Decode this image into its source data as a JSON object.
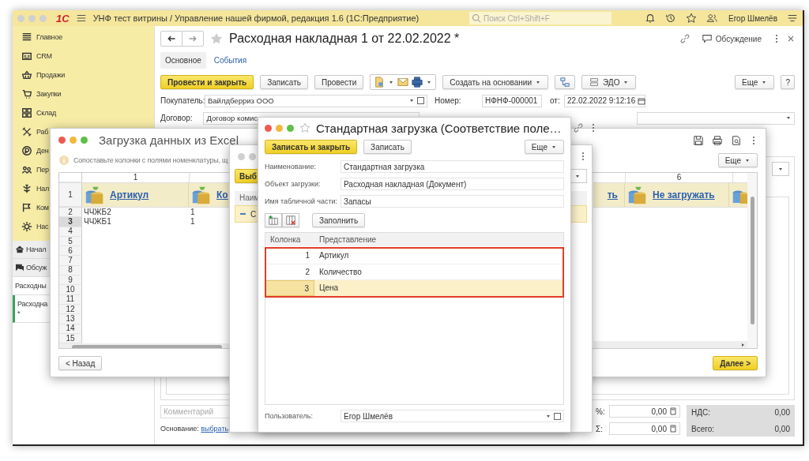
{
  "app": {
    "logo": "1С",
    "title": "УНФ тест витрины / Управление нашей фирмой, редакция 1.6  (1С:Предприятие)",
    "search_placeholder": "Поиск Ctrl+Shift+F",
    "user": "Егор Шмелёв"
  },
  "sidebar": {
    "sections": [
      {
        "label": "Главное"
      },
      {
        "label": "CRM"
      },
      {
        "label": "Продажи"
      },
      {
        "label": "Закупки"
      },
      {
        "label": "Склад"
      },
      {
        "label": "Раб"
      },
      {
        "label": "Ден"
      },
      {
        "label": "Пер"
      },
      {
        "label": "Нал"
      },
      {
        "label": "Ком"
      },
      {
        "label": "Нас"
      }
    ],
    "open_items": [
      {
        "kind": "section",
        "label": "Начал",
        "selected": false
      },
      {
        "kind": "section",
        "label": "Обсуж",
        "selected": false
      },
      {
        "kind": "document",
        "label": "Расходны",
        "selected": false
      },
      {
        "kind": "document",
        "label": "Расходна",
        "note": "*",
        "selected": true
      }
    ]
  },
  "document": {
    "title": "Расходная накладная 1 от 22.02.2022 *",
    "discussion": "Обсуждение",
    "tabs": [
      {
        "label": "Основное",
        "selected": true
      },
      {
        "label": "События",
        "selected": false
      }
    ],
    "toolbar": {
      "primary": "Провести и закрыть",
      "buttons": [
        "Записать",
        "Провести"
      ],
      "create_based": "Создать на основании",
      "edo": "ЭДО",
      "more": "Еще",
      "help": "?"
    },
    "fields": {
      "buyer_label": "Покупатель:",
      "buyer": "Вайлдберриз ООО",
      "number_label": "Номер:",
      "number": "НФНФ-000001",
      "date_label": "от:",
      "date": "22.02.2022  9:12:16",
      "contract_label": "Договор:",
      "contract": "Договор комис"
    },
    "footer": {
      "comment_placeholder": "Комментарий",
      "basis_label": "Основание:",
      "basis_link": "выбрать",
      "totals": [
        {
          "label": "%:",
          "value": "0,00"
        },
        {
          "label": "Σ:",
          "value": "0,00"
        }
      ],
      "summary": [
        {
          "label": "НДС:",
          "value": "0,00"
        },
        {
          "label": "Всего:",
          "value": "0,00"
        }
      ]
    }
  },
  "excel_dialog": {
    "title": "Загрузка данных из Excel",
    "hint": "Сопоставьте колонки с полями номенклатуры, щ",
    "more": "Еще",
    "header_row": "1",
    "left_columns": [
      {
        "number": "1",
        "field": "Артикул"
      },
      {
        "field": "Ко"
      }
    ],
    "right_columns": [
      {
        "field": "ть"
      },
      {
        "number": "6",
        "field": "Не загружать"
      }
    ],
    "rows": [
      {
        "number": "2",
        "cells": [
          "ЧЧЖБ2",
          "1"
        ],
        "selected": false
      },
      {
        "number": "3",
        "cells": [
          "ЧЧЖБ1",
          "1"
        ],
        "selected": true
      },
      {
        "number": "4",
        "selected": false
      },
      {
        "number": "5",
        "selected": false
      },
      {
        "number": "6",
        "selected": false
      },
      {
        "number": "7",
        "selected": false
      },
      {
        "number": "8",
        "selected": false
      },
      {
        "number": "9",
        "selected": false
      },
      {
        "number": "10",
        "selected": false
      },
      {
        "number": "11",
        "selected": false
      },
      {
        "number": "12",
        "selected": false
      },
      {
        "number": "13",
        "selected": false
      },
      {
        "number": "14",
        "selected": false
      },
      {
        "number": "15",
        "selected": false
      }
    ],
    "back": "< Назад",
    "next": "Далее >"
  },
  "templates_window": {
    "button": "Выб",
    "column": "Наим",
    "row": "С"
  },
  "mapping_dialog": {
    "title": "Стандартная загрузка (Соответствие поле…",
    "save_close": "Записать и закрыть",
    "save": "Записать",
    "more": "Еще",
    "fields": [
      {
        "label": "Наименование:",
        "value": "Стандартная загрузка"
      },
      {
        "label": "Объект загрузки:",
        "value": "Расходная накладная (Документ)"
      },
      {
        "label": "Имя табличной части:",
        "value": "Запасы"
      }
    ],
    "fill": "Заполнить",
    "table": {
      "columns": [
        "Колонка",
        "Представление"
      ],
      "highlighted": true,
      "rows": [
        {
          "column": "1",
          "presentation": "Артикул",
          "selected": false
        },
        {
          "column": "2",
          "presentation": "Количество",
          "selected": false
        },
        {
          "column": "3",
          "presentation": "Цена",
          "selected": true
        }
      ]
    },
    "user_label": "Пользователь:",
    "user": "Егор Шмелёв"
  }
}
